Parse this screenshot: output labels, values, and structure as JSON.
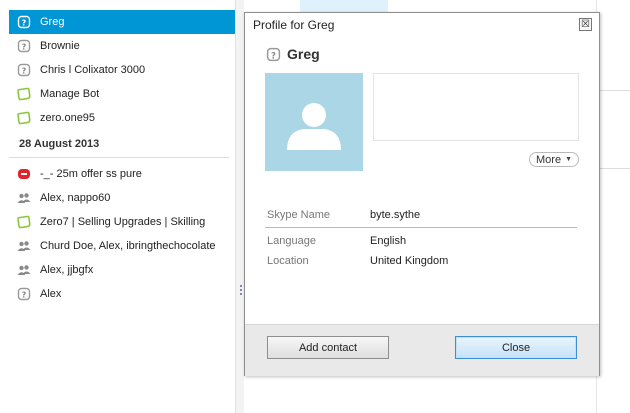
{
  "contacts_top": [
    {
      "label": "Greg",
      "icon": "skype-unknown-icon",
      "selected": true
    },
    {
      "label": "Brownie",
      "icon": "skype-unknown-icon"
    },
    {
      "label": "Chris l Colixator 3000",
      "icon": "skype-unknown-icon"
    },
    {
      "label": "Manage Bot",
      "icon": "status-online-icon"
    },
    {
      "label": "zero.one95",
      "icon": "status-online-icon"
    }
  ],
  "date_group": "28 August 2013",
  "contacts_bottom": [
    {
      "label": "-_- 25m offer ss pure",
      "icon": "skype-blocked-icon"
    },
    {
      "label": "Alex, nappo60",
      "icon": "group-chat-icon"
    },
    {
      "label": "Zero7 | Selling Upgrades | Skilling",
      "icon": "status-online-icon"
    },
    {
      "label": "Churd Doe, Alex, ibringthechocolate",
      "icon": "group-chat-icon"
    },
    {
      "label": "Alex, jjbgfx",
      "icon": "group-chat-icon"
    },
    {
      "label": "Alex",
      "icon": "skype-unknown-icon"
    }
  ],
  "dialog": {
    "title": "Profile for Greg",
    "close_glyph": "☒",
    "name": "Greg",
    "more_label": "More",
    "skype_name_label": "Skype Name",
    "skype_name_value": "byte.sythe",
    "language_label": "Language",
    "language_value": "English",
    "location_label": "Location",
    "location_value": "United Kingdom",
    "add_contact_label": "Add contact",
    "close_label": "Close"
  },
  "colors": {
    "selected_bg": "#0096d6",
    "avatar_bg": "#aad6e6",
    "online_green": "#8cc63e",
    "blocked_red": "#e0242c"
  }
}
